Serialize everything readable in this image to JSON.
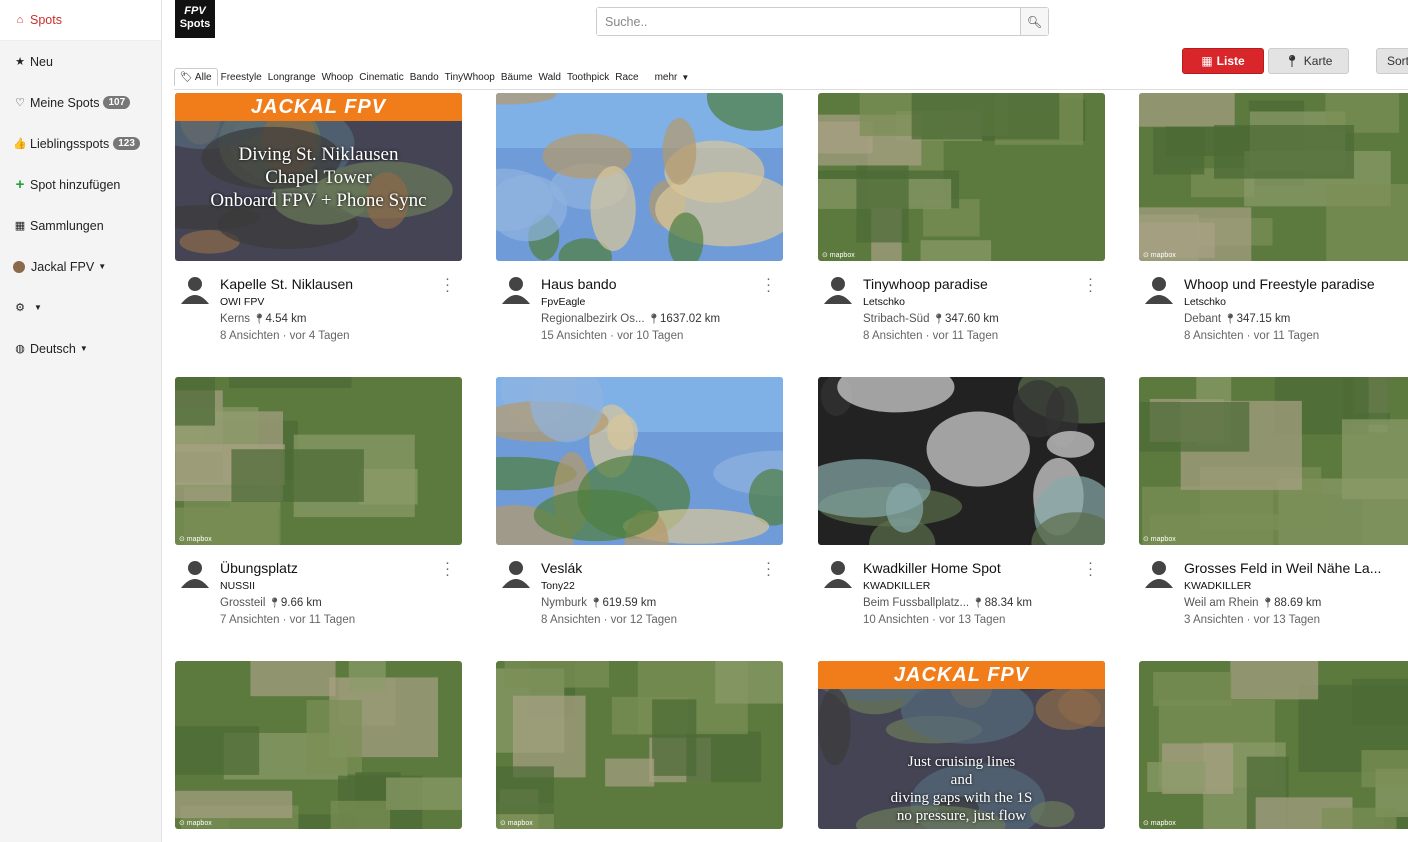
{
  "sidebar": {
    "items": [
      {
        "icon": "home-icon",
        "glyph": "⌂",
        "label": "Spots",
        "active": true
      },
      {
        "icon": "star-icon",
        "glyph": "★",
        "label": "Neu"
      },
      {
        "icon": "heart-icon",
        "glyph": "♡",
        "label": "Meine Spots",
        "badge": "107"
      },
      {
        "icon": "thumbs-up-icon",
        "glyph": "👍",
        "label": "Lieblingsspots",
        "badge": "123"
      },
      {
        "icon": "plus-icon",
        "glyph": "+",
        "label": "Spot hinzufügen"
      },
      {
        "icon": "grid-icon",
        "glyph": "▦",
        "label": "Sammlungen"
      },
      {
        "icon": "user-avatar",
        "label": "Jackal FPV",
        "caret": true
      },
      {
        "icon": "gear-icon",
        "glyph": "⚙",
        "label": "",
        "caret": true
      },
      {
        "icon": "globe-icon",
        "glyph": "◍",
        "label": "Deutsch",
        "caret": true
      }
    ]
  },
  "logo": {
    "line1": "FPV",
    "line2": "Spots"
  },
  "search": {
    "placeholder": "Suche.."
  },
  "view": {
    "liste": "Liste",
    "karte": "Karte",
    "sort": "Sort"
  },
  "tags": [
    "Alle",
    "Freestyle",
    "Longrange",
    "Whoop",
    "Cinematic",
    "Bando",
    "TinyWhoop",
    "Bäume",
    "Wald",
    "Toothpick",
    "Race"
  ],
  "tags_more": "mehr",
  "colors": {
    "accent": "#d9262b",
    "sidebar_bg": "#f4f4f4"
  },
  "spots": [
    {
      "title": "Kapelle St. Niklausen",
      "author": "OWI FPV",
      "location": "Kerns",
      "distance": "4.54 km",
      "views": "8 Ansichten · vor 4 Tagen",
      "thumb": "video",
      "overlay_title": "JACKAL FPV",
      "overlay_text": "Diving St. Niklausen\nChapel Tower\nOnboard FPV + Phone Sync"
    },
    {
      "title": "Haus bando",
      "author": "FpvEagle",
      "location": "Regionalbezirk Os...",
      "distance": "1637.02 km",
      "views": "15 Ansichten · vor 10 Tagen",
      "thumb": "photo"
    },
    {
      "title": "Tinywhoop paradise",
      "author": "Letschko",
      "location": "Stribach-Süd",
      "distance": "347.60 km",
      "views": "8 Ansichten · vor 11 Tagen",
      "thumb": "map"
    },
    {
      "title": "Whoop und Freestyle paradise",
      "author": "Letschko",
      "location": "Debant",
      "distance": "347.15 km",
      "views": "8 Ansichten · vor 11 Tagen",
      "thumb": "map"
    },
    {
      "title": "Übungsplatz",
      "author": "NUSSII",
      "location": "Grossteil",
      "distance": "9.66 km",
      "views": "7 Ansichten · vor 11 Tagen",
      "thumb": "map"
    },
    {
      "title": "Veslák",
      "author": "Tony22",
      "location": "Nymburk",
      "distance": "619.59 km",
      "views": "8 Ansichten · vor 12 Tagen",
      "thumb": "photo"
    },
    {
      "title": "Kwadkiller Home Spot",
      "author": "KWADKILLER",
      "location": "Beim Fussballplatz...",
      "distance": "88.34 km",
      "views": "10 Ansichten · vor 13 Tagen",
      "thumb": "art"
    },
    {
      "title": "Grosses Feld in Weil Nähe La...",
      "author": "KWADKILLER",
      "location": "Weil am Rhein",
      "distance": "88.69 km",
      "views": "3 Ansichten · vor 13 Tagen",
      "thumb": "map"
    },
    {
      "thumb": "map"
    },
    {
      "thumb": "map"
    },
    {
      "thumb": "video",
      "overlay_title": "JACKAL FPV",
      "overlay_text": "Just cruising lines\nand\ndiving gaps with the 1S\nno pressure, just flow"
    },
    {
      "thumb": "map"
    }
  ]
}
